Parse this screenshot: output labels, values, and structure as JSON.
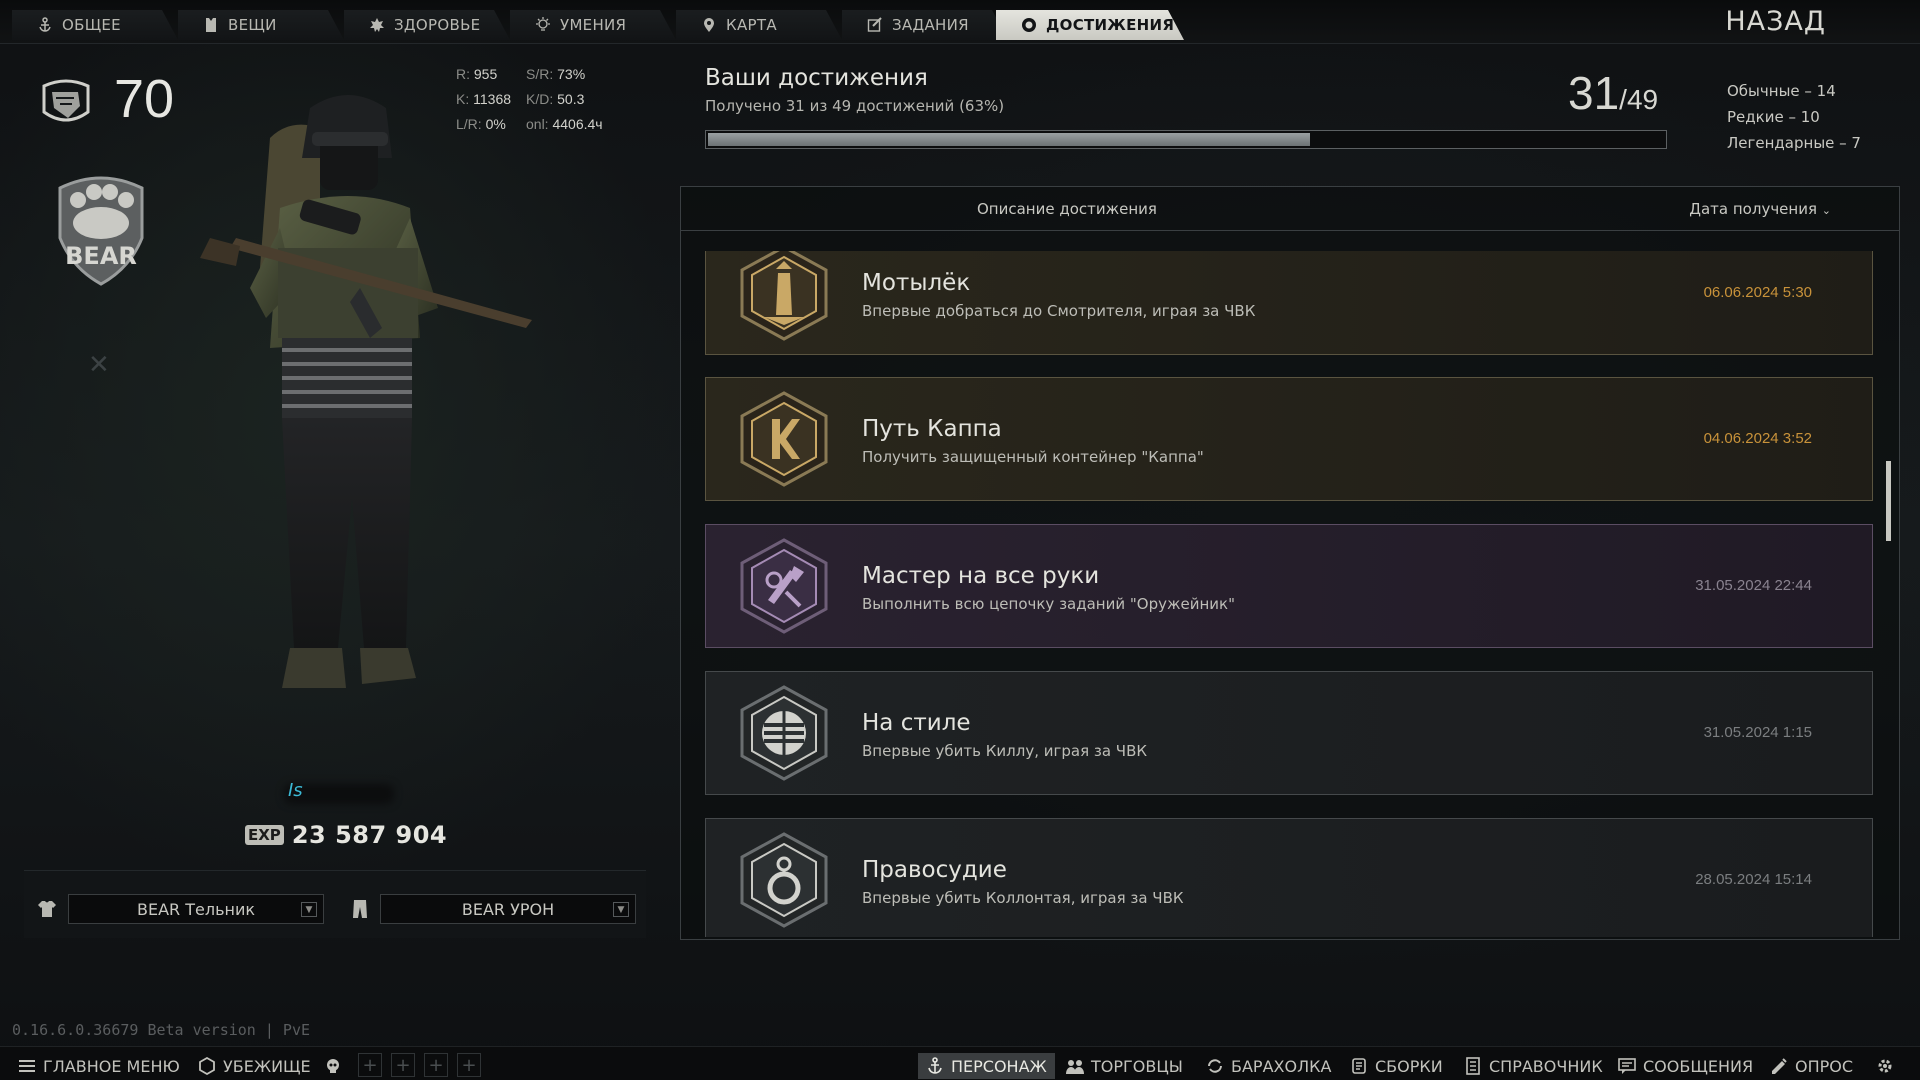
{
  "top_nav": {
    "tabs": [
      {
        "label": "ОБЩЕЕ",
        "icon": "anchor-icon",
        "active": false
      },
      {
        "label": "ВЕЩИ",
        "icon": "vest-icon",
        "active": false
      },
      {
        "label": "ЗДОРОВЬЕ",
        "icon": "health-icon",
        "active": false
      },
      {
        "label": "УМЕНИЯ",
        "icon": "bulb-icon",
        "active": false
      },
      {
        "label": "КАРТА",
        "icon": "map-pin-icon",
        "active": false
      },
      {
        "label": "ЗАДАНИЯ",
        "icon": "tasks-icon",
        "active": false
      },
      {
        "label": "ДОСТИЖЕНИЯ",
        "icon": "achievement-icon",
        "active": true
      }
    ],
    "back_label": "НАЗАД"
  },
  "character": {
    "level": "70",
    "stats": {
      "r_label": "R:",
      "r_value": "955",
      "sr_label": "S/R:",
      "sr_value": "73%",
      "k_label": "K:",
      "k_value": "11368",
      "kd_label": "K/D:",
      "kd_value": "50.3",
      "lr_label": "L/R:",
      "lr_value": "0%",
      "onl_label": "onl:",
      "onl_value": "4406.4ч"
    },
    "exp_label": "EXP",
    "exp_value": "23 587 904",
    "faction_logo_text": "BEAR",
    "upper_body": "BEAR Тельник",
    "lower_body": "BEAR УРОН"
  },
  "achievements": {
    "title": "Ваши достижения",
    "subtitle": "Получено 31 из 49 достижений (63%)",
    "progress": 0.63,
    "count_done": "31",
    "count_total": "/49",
    "legend": [
      "Обычные – 14",
      "Редкие – 10",
      "Легендарные – 7"
    ],
    "header_desc": "Описание достижения",
    "header_date": "Дата получения",
    "items": [
      {
        "title": "Мотылёк",
        "desc": "Впервые добраться до Смотрителя, играя за ЧВК",
        "date": "06.06.2024 5:30",
        "rarity": "legendary",
        "icon": "lighthouse-icon"
      },
      {
        "title": "Путь Каппа",
        "desc": "Получить защищенный контейнер \"Каппа\"",
        "date": "04.06.2024 3:52",
        "rarity": "legendary",
        "icon": "kappa-icon"
      },
      {
        "title": "Мастер на все руки",
        "desc": "Выполнить всю цепочку заданий \"Оружейник\"",
        "date": "31.05.2024 22:44",
        "rarity": "rare",
        "icon": "tools-icon"
      },
      {
        "title": "На стиле",
        "desc": "Впервые убить Киллу, играя за ЧВК",
        "date": "31.05.2024 1:15",
        "rarity": "common",
        "icon": "helmet-icon"
      },
      {
        "title": "Правосудие",
        "desc": "Впервые убить Коллонтая, играя за ЧВК",
        "date": "28.05.2024 15:14",
        "rarity": "common",
        "icon": "handcuffs-icon"
      }
    ],
    "rarity_colors": {
      "legendary": "#c8923a",
      "rare": "#8a8390",
      "common": "#7b7e80"
    }
  },
  "version": "0.16.6.0.36679 Beta version | PvE",
  "bottom_bar": {
    "main_menu": "ГЛАВНОЕ МЕНЮ",
    "hideout": "УБЕЖИЩЕ",
    "character": "ПЕРСОНАЖ",
    "traders": "ТОРГОВЦЫ",
    "flea": "БАРАХОЛКА",
    "builds": "СБОРКИ",
    "handbook": "СПРАВОЧНИК",
    "messages": "СООБЩЕНИЯ",
    "survey": "ОПРОС"
  }
}
